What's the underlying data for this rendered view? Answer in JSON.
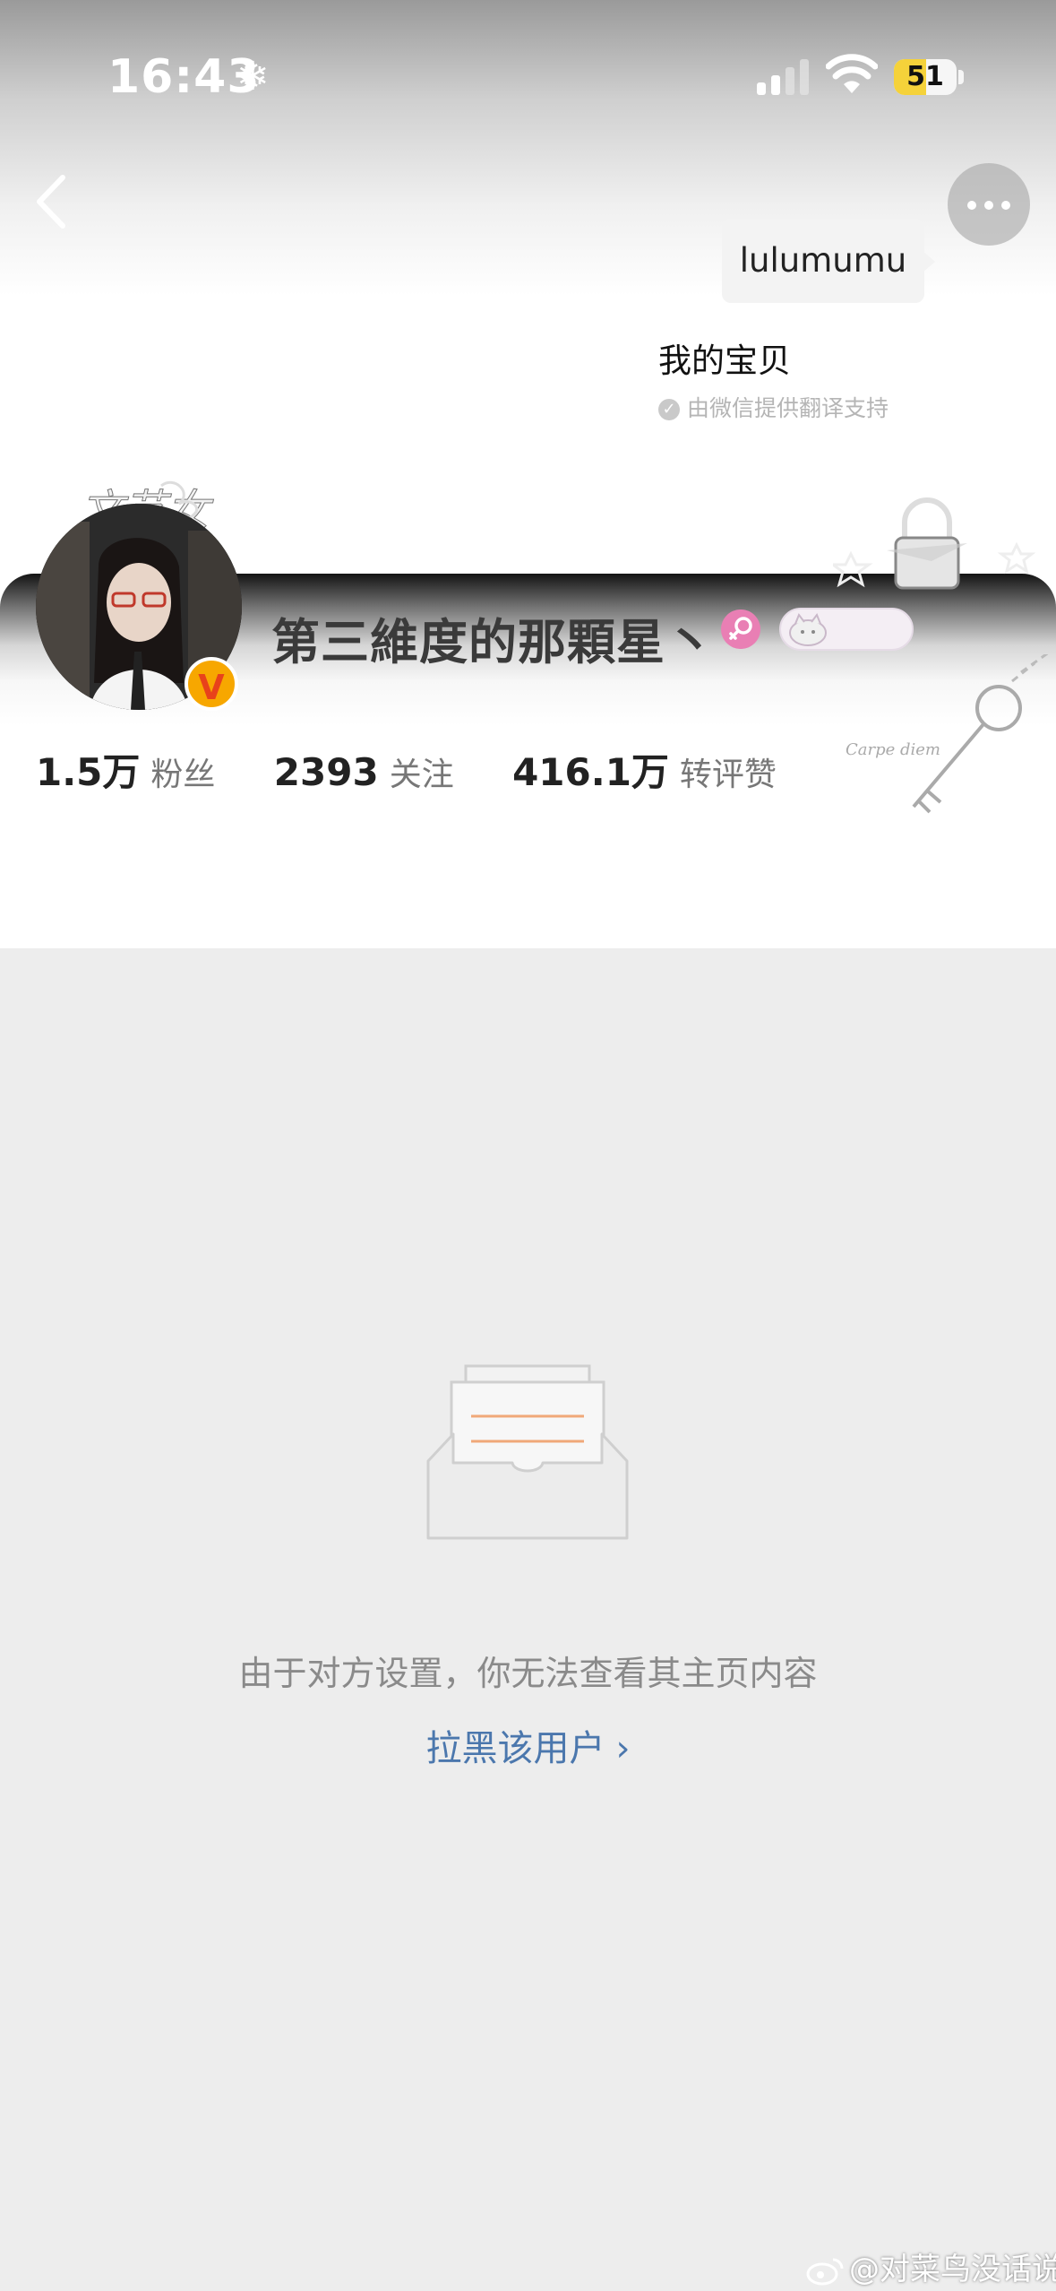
{
  "status_bar": {
    "time": "16:43",
    "battery": "51",
    "battery_level": 0.51,
    "icons": [
      "snowflake-icon",
      "cellular-signal-icon",
      "wifi-icon",
      "battery-icon"
    ]
  },
  "nav": {
    "back_icon": "chevron-left-icon",
    "more_icon": "more-dots-icon"
  },
  "bubble": {
    "original": "lulumumu",
    "translation": "我的宝贝",
    "translation_note": "由微信提供翻译支持"
  },
  "profile": {
    "avatar_caption": "文艺女",
    "name": "第三維度的那顆星丶",
    "gender": "female",
    "verified": "V"
  },
  "stats": [
    {
      "value": "1.5万",
      "label": "粉丝"
    },
    {
      "value": "2393",
      "label": "关注"
    },
    {
      "value": "416.1万",
      "label": "转评赞"
    }
  ],
  "empty_state": {
    "message": "由于对方设置，你无法查看其主页内容",
    "action": "拉黑该用户",
    "action_icon": "chevron-right-icon"
  },
  "watermark": "@对菜鸟没话说",
  "colors": {
    "link": "#4b77ad",
    "badge": "#f7a700",
    "gender": "#e97fb4",
    "battery_fill": "#f5d23a"
  }
}
